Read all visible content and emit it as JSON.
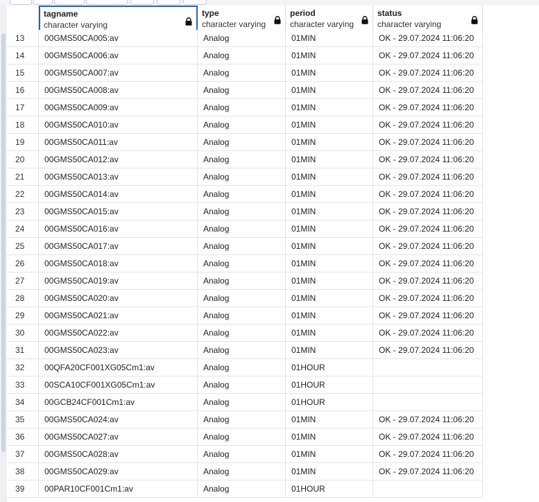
{
  "columns": [
    {
      "name": "tagname",
      "type": "character varying"
    },
    {
      "name": "type",
      "type": "character varying"
    },
    {
      "name": "period",
      "type": "character varying"
    },
    {
      "name": "status",
      "type": "character varying"
    }
  ],
  "rows": [
    {
      "n": "13",
      "tagname": "00GMS50CA005:av",
      "type": "Analog",
      "period": "01MIN",
      "status": "OK - 29.07.2024 11:06:20"
    },
    {
      "n": "14",
      "tagname": "00GMS50CA006:av",
      "type": "Analog",
      "period": "01MIN",
      "status": "OK - 29.07.2024 11:06:20"
    },
    {
      "n": "15",
      "tagname": "00GMS50CA007:av",
      "type": "Analog",
      "period": "01MIN",
      "status": "OK - 29.07.2024 11:06:20"
    },
    {
      "n": "16",
      "tagname": "00GMS50CA008:av",
      "type": "Analog",
      "period": "01MIN",
      "status": "OK - 29.07.2024 11:06:20"
    },
    {
      "n": "17",
      "tagname": "00GMS50CA009:av",
      "type": "Analog",
      "period": "01MIN",
      "status": "OK - 29.07.2024 11:06:20"
    },
    {
      "n": "18",
      "tagname": "00GMS50CA010:av",
      "type": "Analog",
      "period": "01MIN",
      "status": "OK - 29.07.2024 11:06:20"
    },
    {
      "n": "19",
      "tagname": "00GMS50CA011:av",
      "type": "Analog",
      "period": "01MIN",
      "status": "OK - 29.07.2024 11:06:20"
    },
    {
      "n": "20",
      "tagname": "00GMS50CA012:av",
      "type": "Analog",
      "period": "01MIN",
      "status": "OK - 29.07.2024 11:06:20"
    },
    {
      "n": "21",
      "tagname": "00GMS50CA013:av",
      "type": "Analog",
      "period": "01MIN",
      "status": "OK - 29.07.2024 11:06:20"
    },
    {
      "n": "22",
      "tagname": "00GMS50CA014:av",
      "type": "Analog",
      "period": "01MIN",
      "status": "OK - 29.07.2024 11:06:20"
    },
    {
      "n": "23",
      "tagname": "00GMS50CA015:av",
      "type": "Analog",
      "period": "01MIN",
      "status": "OK - 29.07.2024 11:06:20"
    },
    {
      "n": "24",
      "tagname": "00GMS50CA016:av",
      "type": "Analog",
      "period": "01MIN",
      "status": "OK - 29.07.2024 11:06:20"
    },
    {
      "n": "25",
      "tagname": "00GMS50CA017:av",
      "type": "Analog",
      "period": "01MIN",
      "status": "OK - 29.07.2024 11:06:20"
    },
    {
      "n": "26",
      "tagname": "00GMS50CA018:av",
      "type": "Analog",
      "period": "01MIN",
      "status": "OK - 29.07.2024 11:06:20"
    },
    {
      "n": "27",
      "tagname": "00GMS50CA019:av",
      "type": "Analog",
      "period": "01MIN",
      "status": "OK - 29.07.2024 11:06:20"
    },
    {
      "n": "28",
      "tagname": "00GMS50CA020:av",
      "type": "Analog",
      "period": "01MIN",
      "status": "OK - 29.07.2024 11:06:20"
    },
    {
      "n": "29",
      "tagname": "00GMS50CA021:av",
      "type": "Analog",
      "period": "01MIN",
      "status": "OK - 29.07.2024 11:06:20"
    },
    {
      "n": "30",
      "tagname": "00GMS50CA022:av",
      "type": "Analog",
      "period": "01MIN",
      "status": "OK - 29.07.2024 11:06:20"
    },
    {
      "n": "31",
      "tagname": "00GMS50CA023:av",
      "type": "Analog",
      "period": "01MIN",
      "status": "OK - 29.07.2024 11:06:20"
    },
    {
      "n": "32",
      "tagname": "00QFA20CF001XG05Cm1:av",
      "type": "Analog",
      "period": "01HOUR",
      "status": ""
    },
    {
      "n": "33",
      "tagname": "00SCA10CF001XG05Cm1:av",
      "type": "Analog",
      "period": "01HOUR",
      "status": ""
    },
    {
      "n": "34",
      "tagname": "00GCB24CF001Cm1:av",
      "type": "Analog",
      "period": "01HOUR",
      "status": ""
    },
    {
      "n": "35",
      "tagname": "00GMS50CA024:av",
      "type": "Analog",
      "period": "01MIN",
      "status": "OK - 29.07.2024 11:06:20"
    },
    {
      "n": "36",
      "tagname": "00GMS50CA027:av",
      "type": "Analog",
      "period": "01MIN",
      "status": "OK - 29.07.2024 11:06:20"
    },
    {
      "n": "37",
      "tagname": "00GMS50CA028:av",
      "type": "Analog",
      "period": "01MIN",
      "status": "OK - 29.07.2024 11:06:20"
    },
    {
      "n": "38",
      "tagname": "00GMS50CA029:av",
      "type": "Analog",
      "period": "01MIN",
      "status": "OK - 29.07.2024 11:06:20"
    },
    {
      "n": "39",
      "tagname": "00PAR10CF001Cm1:av",
      "type": "Analog",
      "period": "01HOUR",
      "status": ""
    }
  ],
  "icons": {
    "column_lock": "lock-icon"
  },
  "colors": {
    "active_column_border": "#2c5fbf",
    "grid_line": "#e2e5e9"
  }
}
